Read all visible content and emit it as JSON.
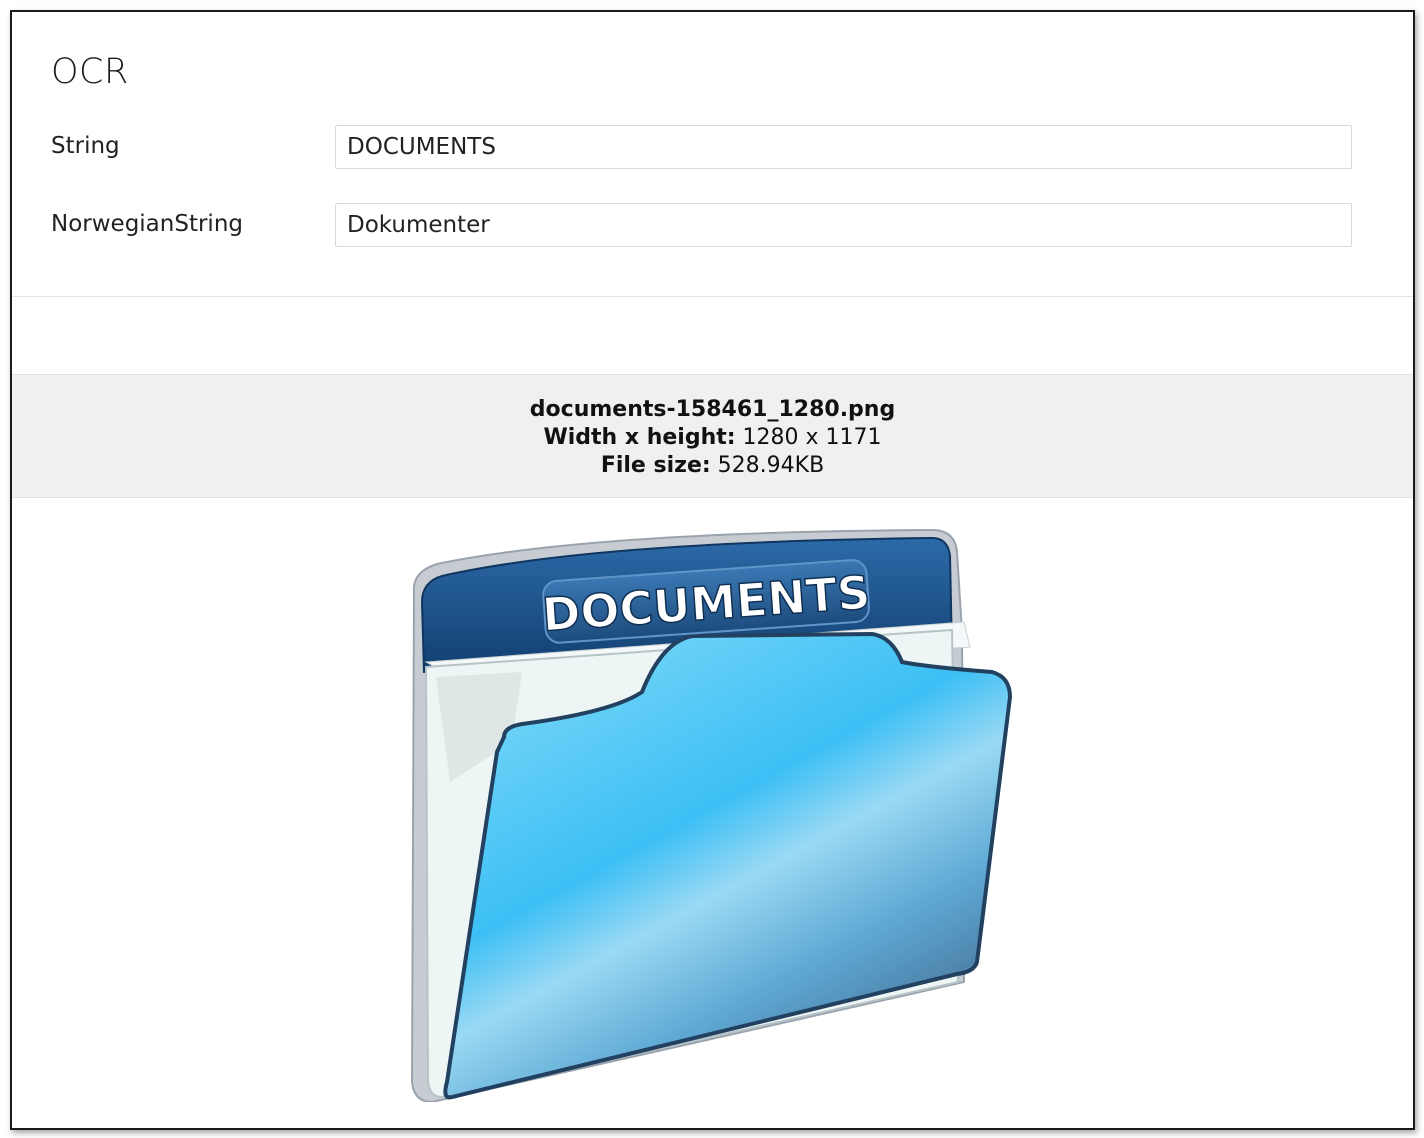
{
  "section": {
    "title": "OCR"
  },
  "fields": [
    {
      "label": "String",
      "value": "DOCUMENTS"
    },
    {
      "label": "NorwegianString",
      "value": "Dokumenter"
    }
  ],
  "file_info": {
    "filename": "documents-158461_1280.png",
    "dimensions_label": "Width x height:",
    "dimensions_value": "1280 x 1171",
    "size_label": "File size:",
    "size_value": "528.94KB"
  },
  "preview": {
    "folder_label": "DOCUMENTS",
    "colors": {
      "tab": "#1b4d84",
      "folder_light": "#7fd6f7",
      "folder_dark": "#3f5f84",
      "paper": "#eef5f5"
    }
  }
}
